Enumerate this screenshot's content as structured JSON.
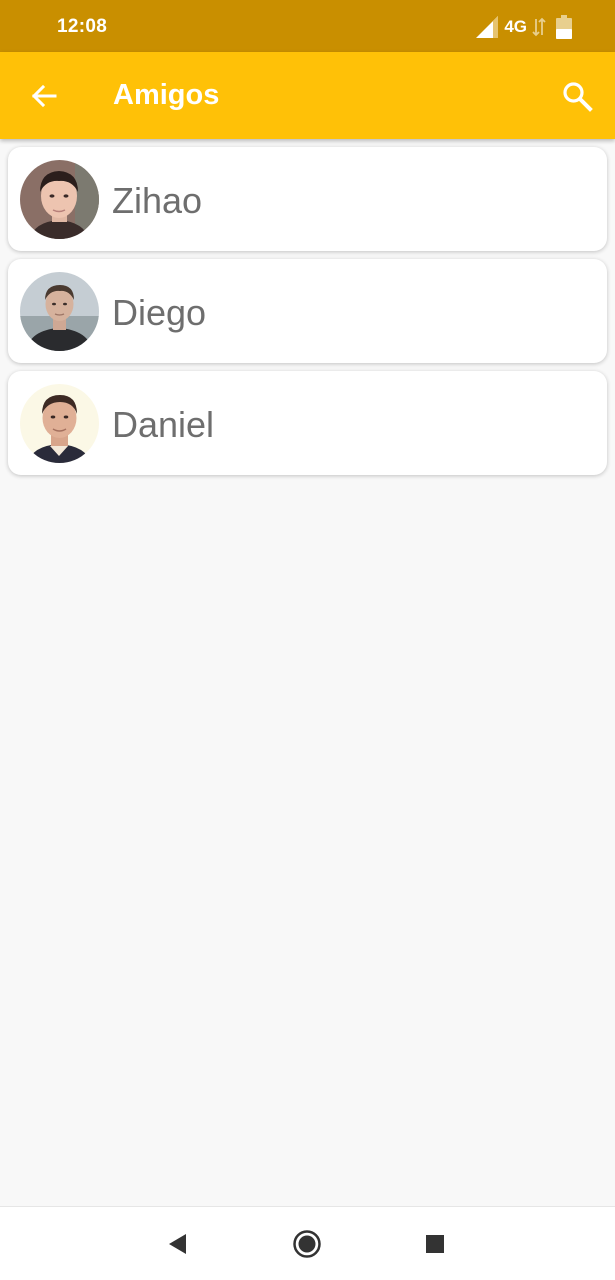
{
  "status_bar": {
    "time": "12:08",
    "network": "4G",
    "icons": [
      "signal-icon",
      "data-transfer-icon",
      "battery-icon"
    ]
  },
  "app_bar": {
    "title": "Amigos",
    "back_icon": "arrow-back-icon",
    "search_icon": "search-icon",
    "background_color": "#ffc107"
  },
  "friends": [
    {
      "name": "Zihao"
    },
    {
      "name": "Diego"
    },
    {
      "name": "Daniel"
    }
  ],
  "nav_bar": {
    "icons": [
      "nav-back-icon",
      "nav-home-icon",
      "nav-recents-icon"
    ]
  },
  "colors": {
    "status_bar": "#c98f00",
    "app_bar": "#ffc107",
    "background": "#f8f8f8",
    "name_text": "#6e6e6e"
  }
}
